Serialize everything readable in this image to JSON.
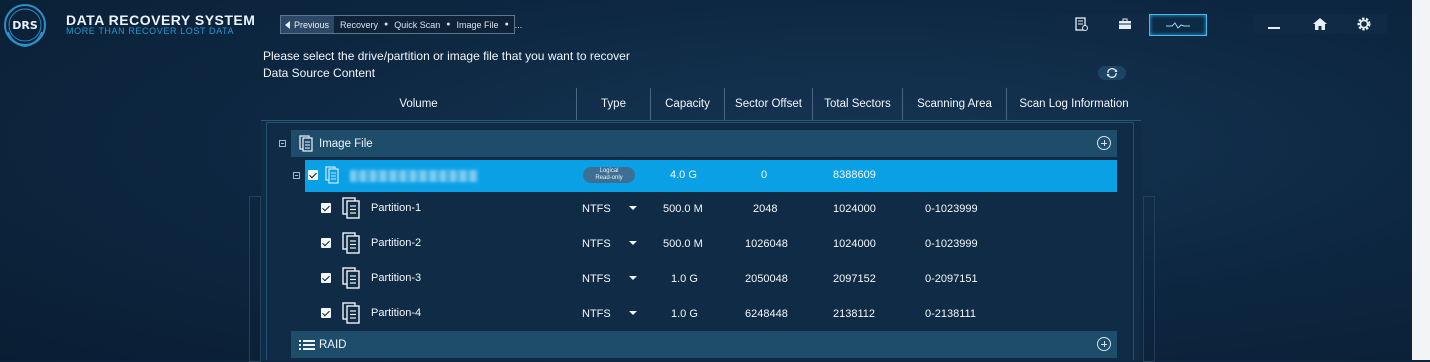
{
  "app": {
    "logo_text": "DRS",
    "title": "DATA RECOVERY SYSTEM",
    "subtitle": "MORE THAN RECOVER LOST DATA"
  },
  "breadcrumb": {
    "previous_label": "Previous",
    "items": [
      "Recovery",
      "Quick Scan",
      "Image File",
      "..."
    ]
  },
  "toolbar": {
    "icons": [
      "report-icon",
      "toolbox-icon",
      "monitor-icon"
    ],
    "window": [
      "minimize-icon",
      "home-icon",
      "settings-icon"
    ]
  },
  "page": {
    "instruction": "Please select the drive/partition or image file that you want to recover",
    "subheading": "Data Source Content"
  },
  "table": {
    "columns": [
      "Volume",
      "Type",
      "Capacity",
      "Sector Offset",
      "Total Sectors",
      "Scanning Area",
      "Scan Log Information"
    ],
    "sections": {
      "image_file": "Image File",
      "raid": "RAID"
    },
    "image_row": {
      "badge_line1": "Logical",
      "badge_line2": "Read-only",
      "capacity": "4.0 G",
      "sector_offset": "0",
      "total_sectors": "8388609"
    },
    "partitions": [
      {
        "name": "Partition-1",
        "type": "NTFS",
        "capacity": "500.0 M",
        "offset": "2048",
        "total": "1024000",
        "area": "0-1023999"
      },
      {
        "name": "Partition-2",
        "type": "NTFS",
        "capacity": "500.0 M",
        "offset": "1026048",
        "total": "1024000",
        "area": "0-1023999"
      },
      {
        "name": "Partition-3",
        "type": "NTFS",
        "capacity": "1.0 G",
        "offset": "2050048",
        "total": "2097152",
        "area": "0-2097151"
      },
      {
        "name": "Partition-4",
        "type": "NTFS",
        "capacity": "1.0 G",
        "offset": "6248448",
        "total": "2138112",
        "area": "0-2138111"
      }
    ]
  },
  "colors": {
    "background": "#0d2640",
    "accent": "#0aa0e6",
    "section": "#1e4d6b"
  }
}
